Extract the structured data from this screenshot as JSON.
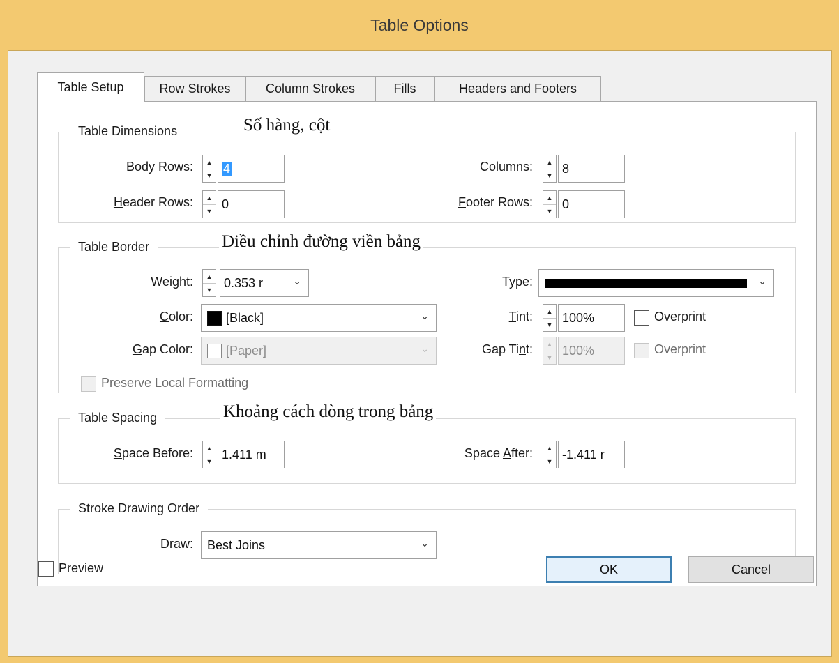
{
  "window": {
    "title": "Table Options"
  },
  "tabs": [
    "Table Setup",
    "Row Strokes",
    "Column Strokes",
    "Fills",
    "Headers and Footers"
  ],
  "dimensions": {
    "title": "Table Dimensions",
    "note": "Số hàng, cột",
    "body_rows": {
      "u": "B",
      "rest": "ody Rows:",
      "value": "4"
    },
    "header_rows": {
      "u": "H",
      "rest": "eader Rows:",
      "value": "0"
    },
    "columns": {
      "pre": "Colu",
      "u": "m",
      "post": "ns:",
      "value": "8"
    },
    "footer_rows": {
      "u": "F",
      "rest": "ooter Rows:",
      "value": "0"
    }
  },
  "border": {
    "title": "Table Border",
    "note": "Điều chỉnh đường viền bảng",
    "weight": {
      "u": "W",
      "rest": "eight:",
      "value": "0.353 r"
    },
    "type": {
      "pre": "Ty",
      "u": "p",
      "post": "e:"
    },
    "color": {
      "u": "C",
      "rest": "olor:",
      "value": "[Black]"
    },
    "tint": {
      "u": "T",
      "rest": "int:",
      "value": "100%"
    },
    "overprint": "Overprint",
    "gap_color": {
      "u": "G",
      "rest": "ap Color:",
      "value": "[Paper]"
    },
    "gap_tint": {
      "pre": "Gap Ti",
      "u": "n",
      "post": "t:",
      "value": "100%"
    },
    "gap_overprint": "Overprint",
    "preserve": "Preserve Local Formatting"
  },
  "spacing": {
    "title": "Table Spacing",
    "note": "Khoảng cách dòng trong bảng",
    "space_before": {
      "u": "S",
      "rest": "pace Before:",
      "value": "1.411 m"
    },
    "space_after": {
      "pre": "Space ",
      "u": "A",
      "post": "fter:",
      "value": "-1.411 r"
    }
  },
  "stroke_order": {
    "title": "Stroke Drawing Order",
    "draw": {
      "u": "D",
      "rest": "raw:",
      "value": "Best Joins"
    }
  },
  "footer": {
    "preview": "Preview",
    "ok": "OK",
    "cancel": "Cancel"
  }
}
